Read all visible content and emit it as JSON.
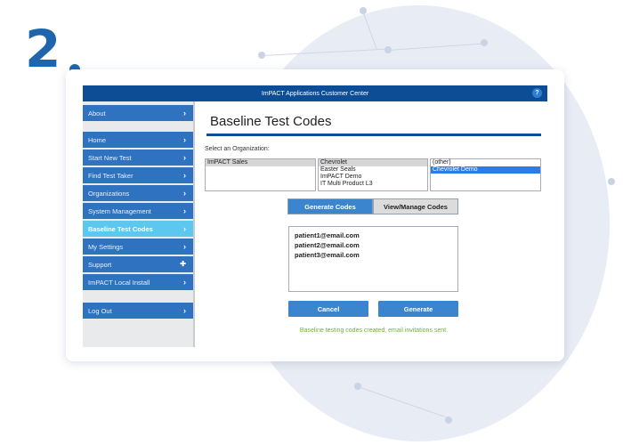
{
  "step": {
    "number": "2"
  },
  "app": {
    "title": "ImPACT Applications Customer Center",
    "help_icon": "question-icon",
    "help_glyph": "?"
  },
  "sidebar": {
    "items": [
      {
        "label": "About",
        "icon": "chevron-right-icon",
        "glyph": "›"
      },
      {
        "label": "Home",
        "icon": "chevron-right-icon",
        "glyph": "›"
      },
      {
        "label": "Start New Test",
        "icon": "chevron-right-icon",
        "glyph": "›"
      },
      {
        "label": "Find Test Taker",
        "icon": "chevron-right-icon",
        "glyph": "›"
      },
      {
        "label": "Organizations",
        "icon": "chevron-right-icon",
        "glyph": "›"
      },
      {
        "label": "System Management",
        "icon": "chevron-right-icon",
        "glyph": "›"
      },
      {
        "label": "Baseline Test Codes",
        "icon": "chevron-right-icon",
        "glyph": "›",
        "active": true
      },
      {
        "label": "My Settings",
        "icon": "chevron-right-icon",
        "glyph": "›"
      },
      {
        "label": "Support",
        "icon": "plus-icon",
        "glyph": "✚"
      },
      {
        "label": "ImPACT Local Install",
        "icon": "chevron-right-icon",
        "glyph": "›"
      },
      {
        "label": "Log Out",
        "icon": "chevron-right-icon",
        "glyph": "›"
      }
    ]
  },
  "main": {
    "title": "Baseline Test Codes",
    "org_label": "Select an Organization:",
    "list1": [
      "ImPACT Sales"
    ],
    "list2": [
      "Chevrolet",
      "Easter Seals",
      "ImPACT Demo",
      "IT Multi Product L3"
    ],
    "list3": [
      "(other)",
      "Chevrolet Demo"
    ],
    "tabs": {
      "generate": "Generate Codes",
      "view": "View/Manage Codes"
    },
    "emails": [
      "patient1@email.com",
      "patient2@email.com",
      "patient3@email.com"
    ],
    "buttons": {
      "cancel": "Cancel",
      "generate": "Generate"
    },
    "success": "Baseline testing codes created, email invitations sent.",
    "colors": {
      "nav": "#2f72bf",
      "active": "#5cc8ef",
      "header": "#0d4d96",
      "success": "#6fb23f"
    }
  }
}
